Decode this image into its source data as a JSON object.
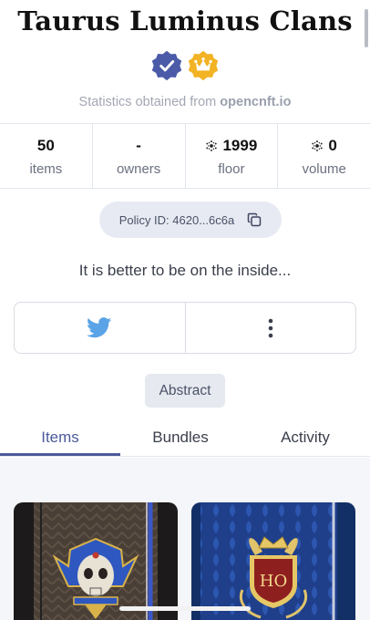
{
  "collection": {
    "title": "Taurus Luminus Clans",
    "badges": [
      "verified-badge-icon",
      "crown-badge-icon"
    ],
    "stats_source_prefix": "Statistics obtained from",
    "stats_source_link": "opencnft.io"
  },
  "stats": [
    {
      "value": "50",
      "label": "items",
      "ada": false
    },
    {
      "value": "-",
      "label": "owners",
      "ada": false
    },
    {
      "value": "1999",
      "label": "floor",
      "ada": true
    },
    {
      "value": "0",
      "label": "volume",
      "ada": true
    }
  ],
  "policy": {
    "label": "Policy ID: 4620...6c6a",
    "icon": "copy-icon"
  },
  "tagline": "It is better to be on the inside...",
  "actions": {
    "twitter_icon": "twitter-icon",
    "more_icon": "more-vertical-icon"
  },
  "category_tag": "Abstract",
  "tabs": [
    {
      "label": "Items",
      "active": true
    },
    {
      "label": "Bundles",
      "active": false
    },
    {
      "label": "Activity",
      "active": false
    }
  ],
  "cards": [
    {
      "art": "skull-pharaoh-emblem"
    },
    {
      "art": "ho-crest-emblem",
      "crest_text": "HO"
    }
  ],
  "colors": {
    "accent": "#4a5a9a",
    "twitter": "#5aa3e6",
    "verified": "#4b5ba8",
    "crown": "#f2b324"
  }
}
